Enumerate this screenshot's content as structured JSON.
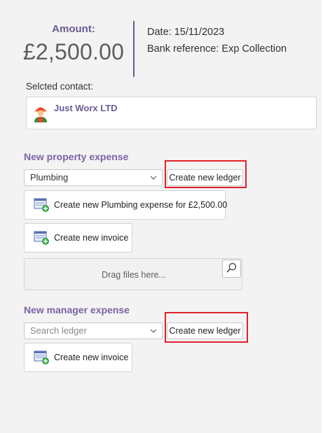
{
  "summary": {
    "amount_label": "Amount:",
    "amount_value": "£2,500.00",
    "date_label": "Date:",
    "date_value": "15/11/2023",
    "bank_ref_label": "Bank reference:",
    "bank_ref_value": "Exp Collection"
  },
  "contact": {
    "label": "Selcted contact:",
    "name": "Just Worx LTD",
    "avatar_icon": "worker-avatar-icon"
  },
  "property_expense": {
    "title": "New property expense",
    "select_value": "Plumbing",
    "create_ledger_label": "Create new ledger",
    "create_expense_label": "Create new Plumbing expense for £2,500.00",
    "create_invoice_label": "Create new invoice",
    "dropzone_text": "Drag files here..."
  },
  "manager_expense": {
    "title": "New manager expense",
    "select_placeholder": "Search ledger",
    "create_ledger_label": "Create new ledger",
    "create_invoice_label": "Create new invoice"
  },
  "colors": {
    "accent_purple": "#6b5b95",
    "highlight_red": "#e0202a",
    "add_green": "#3aa546"
  }
}
